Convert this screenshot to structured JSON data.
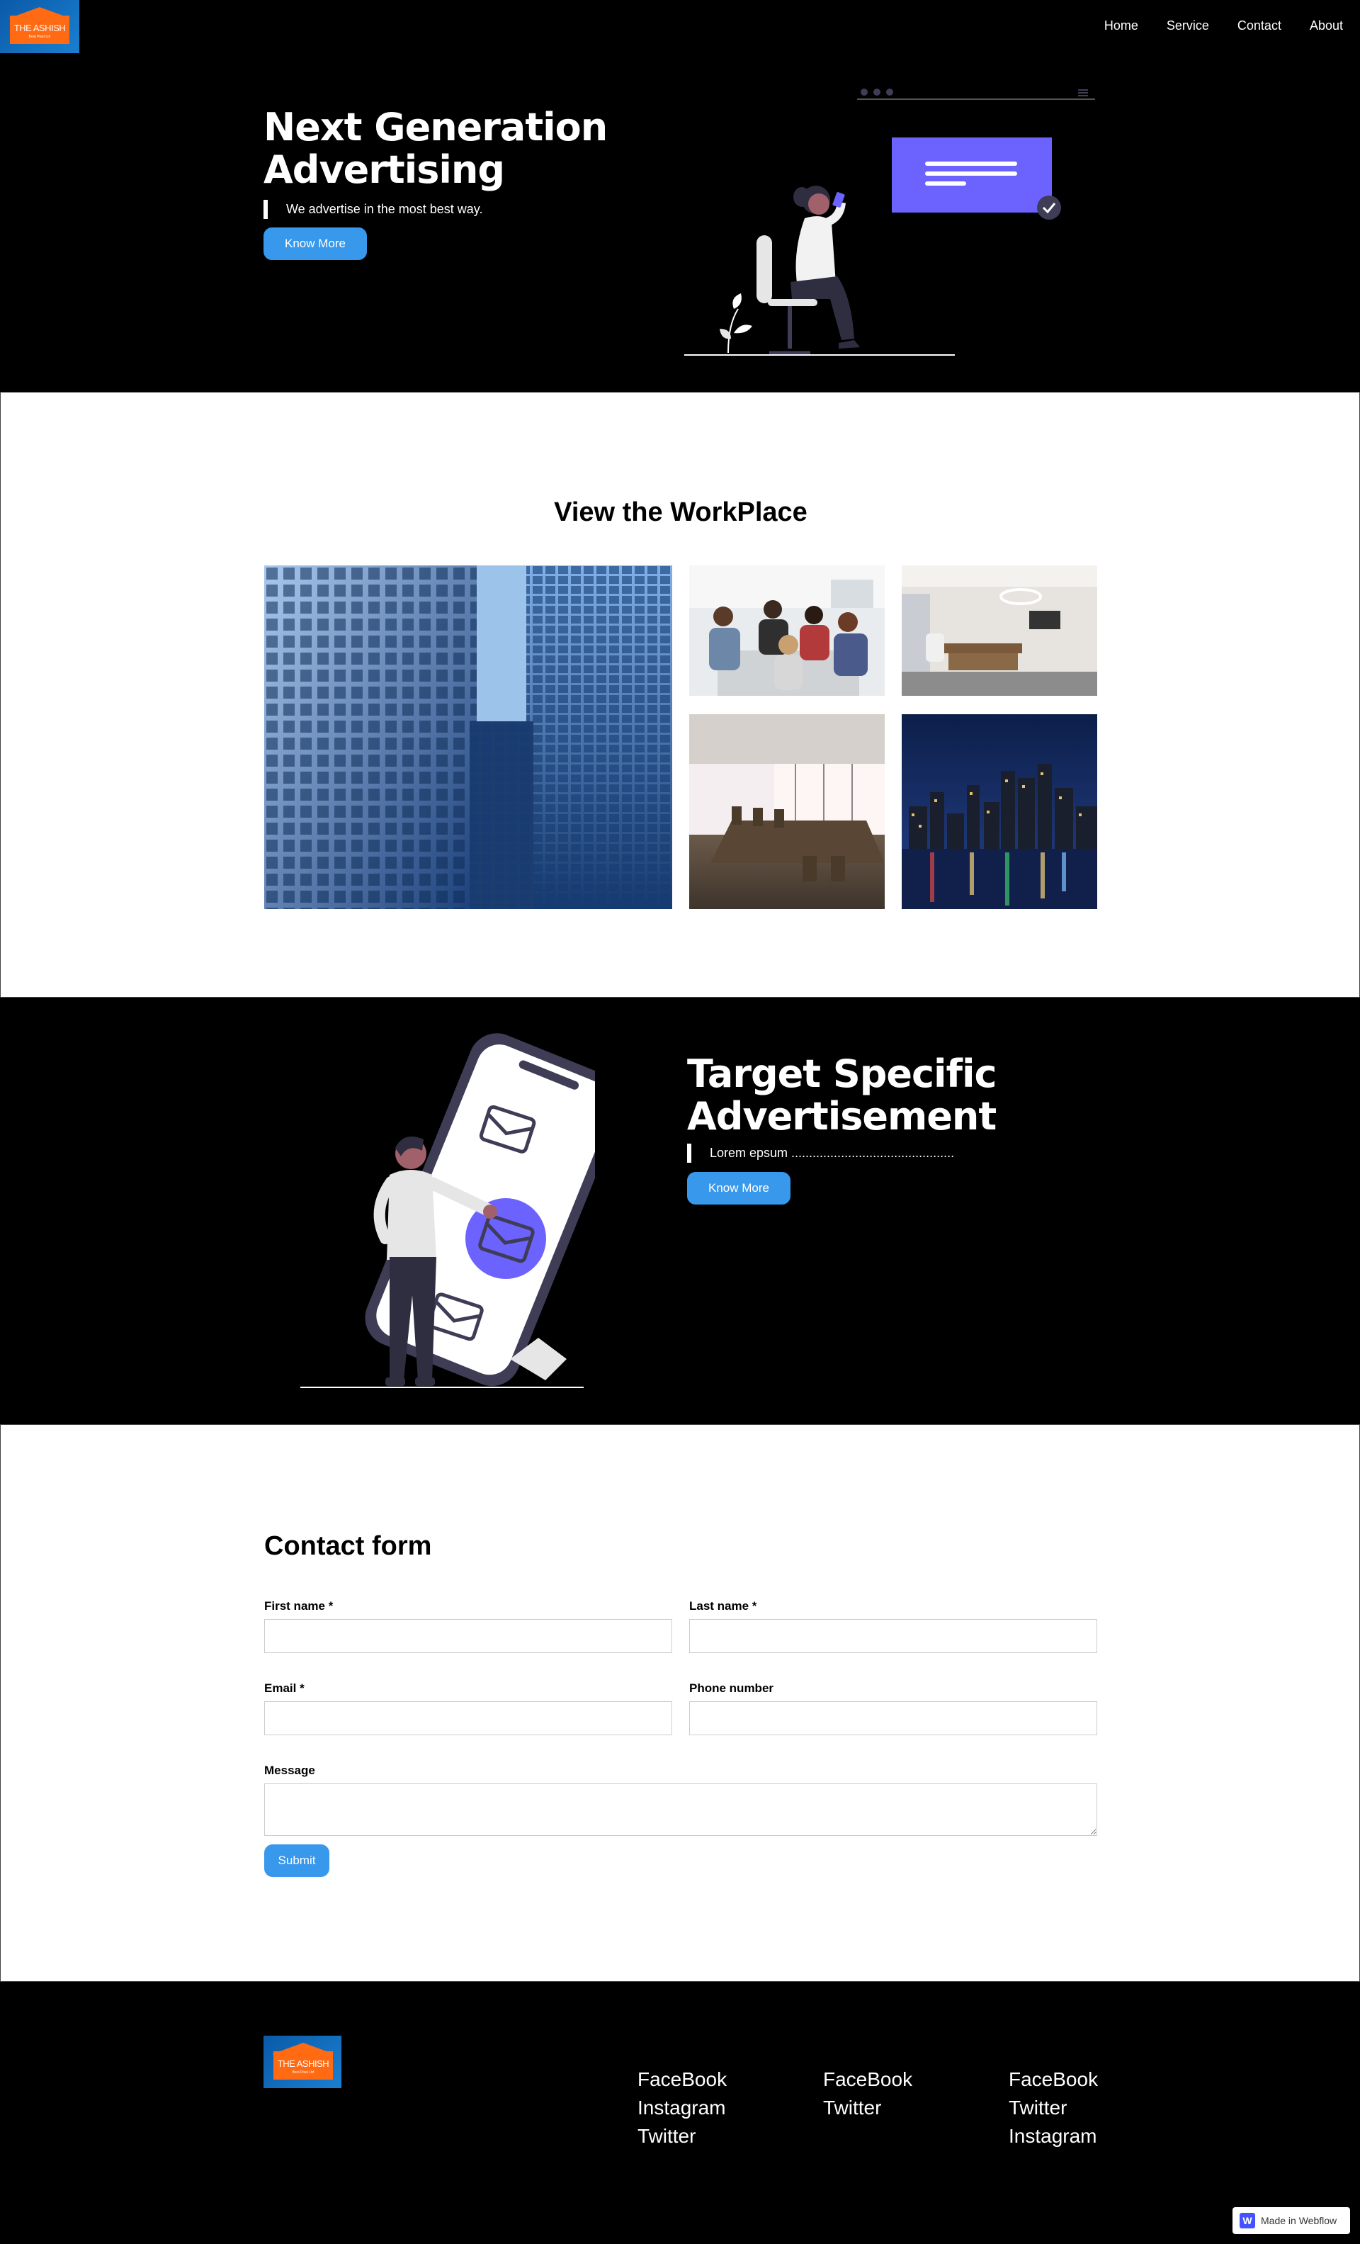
{
  "brand": {
    "logo_text": "THE ASHISH",
    "logo_sub": "Best Pixel Ltd"
  },
  "nav": {
    "items": [
      "Home",
      "Service",
      "Contact",
      "About"
    ]
  },
  "hero": {
    "title": "Next Generation Advertising",
    "tagline": "We advertise in the most best way.",
    "cta_label": "Know More"
  },
  "workplace": {
    "heading": "View the WorkPlace",
    "photos": [
      "office-buildings-photo",
      "team-meeting-photo",
      "executive-office-photo",
      "conference-room-photo",
      "city-skyline-night-photo"
    ]
  },
  "target": {
    "title": "Target Specific Advertisement",
    "tagline": "Lorem epsum ..............................................",
    "cta_label": "Know More"
  },
  "contact": {
    "heading": "Contact form",
    "first_name_label": "First name *",
    "last_name_label": "Last name *",
    "email_label": "Email *",
    "phone_label": "Phone number",
    "message_label": "Message",
    "submit_label": "Submit"
  },
  "footer": {
    "col1": [
      "FaceBook",
      "Instagram",
      "Twitter"
    ],
    "col2": [
      "FaceBook",
      "Twitter"
    ],
    "col3": [
      "FaceBook",
      "Twitter",
      "Instagram"
    ],
    "badge_label": "Made in Webflow"
  },
  "colors": {
    "accent": "#3898ec",
    "illustration_purple": "#6c63ff",
    "dark": "#000000"
  }
}
